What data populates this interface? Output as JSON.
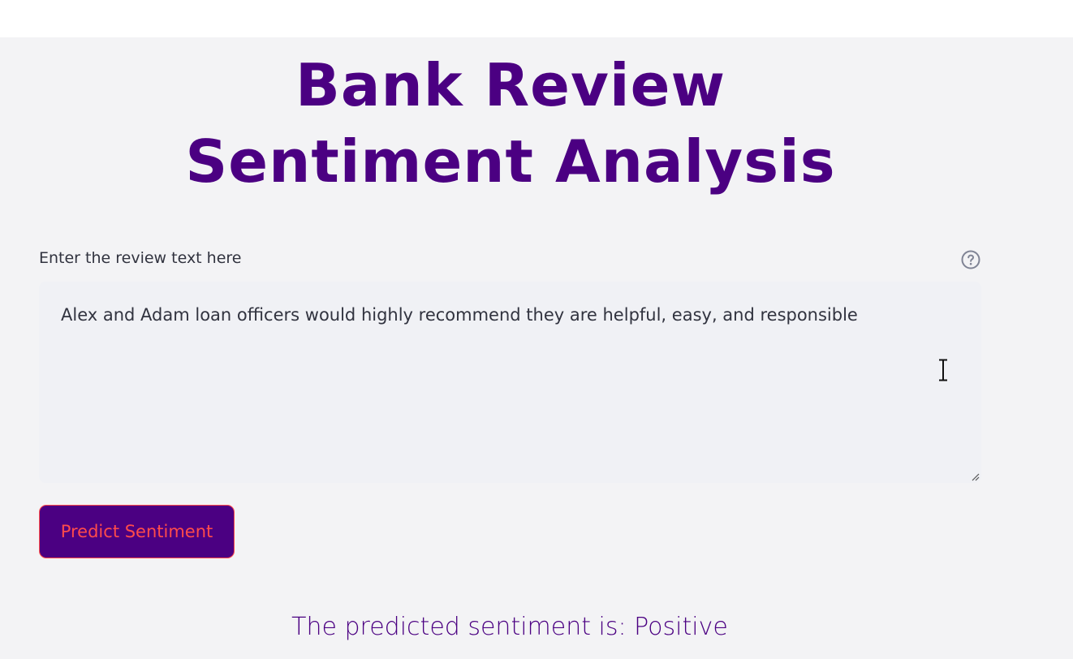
{
  "page": {
    "title": "Bank Review Sentiment Analysis",
    "accent_color": "#4b0082",
    "button_text_color": "#ff4b4b"
  },
  "review_field": {
    "label": "Enter the review text here",
    "value": "Alex and Adam loan officers would highly recommend they are helpful, easy, and responsible",
    "help_icon": "question-circle-icon"
  },
  "predict_button": {
    "label": "Predict Sentiment"
  },
  "result": {
    "text": "The predicted sentiment is: Positive"
  }
}
